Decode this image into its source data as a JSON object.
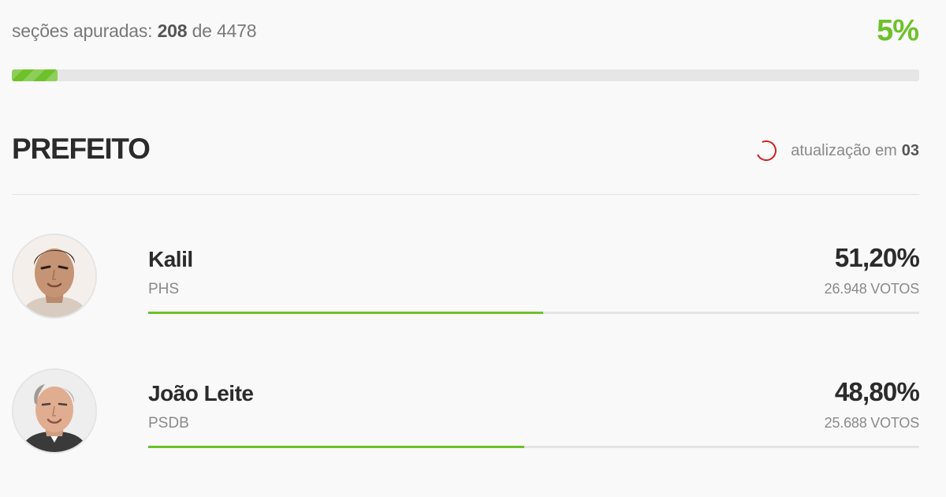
{
  "progress": {
    "label": "seções apuradas:",
    "counted": "208",
    "connector": "de",
    "total": "4478",
    "percent_label": "5%",
    "fraction": 0.05,
    "accent_color": "#6dc12b"
  },
  "office": {
    "title": "PREFEITO"
  },
  "refresh": {
    "label": "atualização em",
    "countdown": "03",
    "spinner_color": "#d21f1f"
  },
  "candidates": [
    {
      "name": "Kalil",
      "party": "PHS",
      "percent": "51,20%",
      "votes": "26.948 VOTOS",
      "share": 0.512
    },
    {
      "name": "João Leite",
      "party": "PSDB",
      "percent": "48,80%",
      "votes": "25.688 VOTOS",
      "share": 0.488
    }
  ]
}
